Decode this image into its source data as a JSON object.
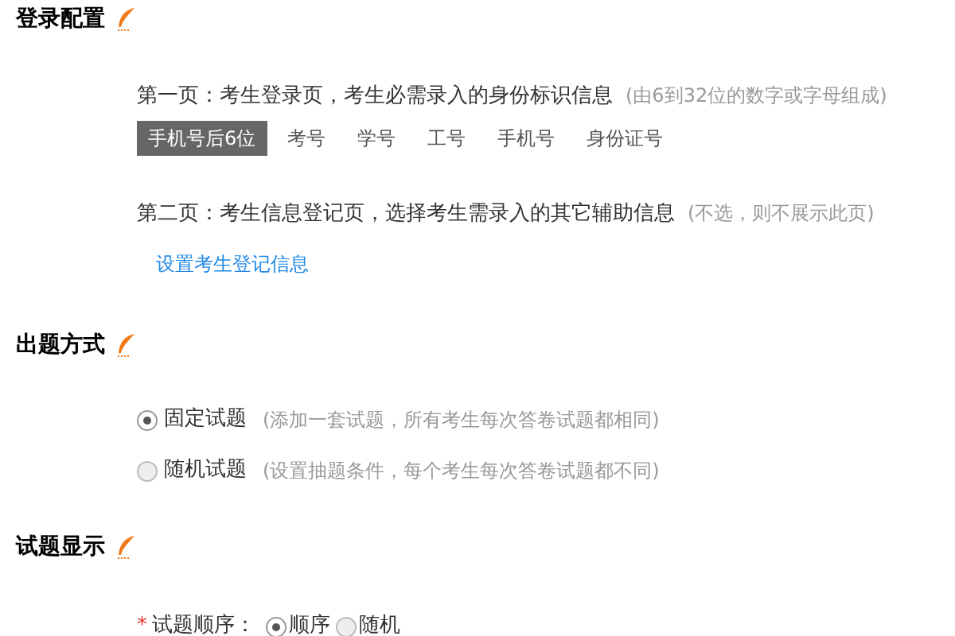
{
  "sections": [
    {
      "title": "登录配置",
      "kind": "login",
      "page1": {
        "label": "第一页：考生登录页，考生必需录入的身份标识信息",
        "note": "(由6到32位的数字或字母组成)"
      },
      "id_options": [
        {
          "label": "手机号后6位",
          "selected": true
        },
        {
          "label": "考号",
          "selected": false
        },
        {
          "label": "学号",
          "selected": false
        },
        {
          "label": "工号",
          "selected": false
        },
        {
          "label": "手机号",
          "selected": false
        },
        {
          "label": "身份证号",
          "selected": false
        }
      ],
      "page2": {
        "label": "第二页：考生信息登记页，选择考生需录入的其它辅助信息",
        "note": "(不选，则不展示此页)"
      },
      "link": "设置考生登记信息"
    },
    {
      "title": "出题方式",
      "kind": "mode",
      "options": [
        {
          "label": "固定试题",
          "note": "(添加一套试题，所有考生每次答卷试题都相同)",
          "selected": true
        },
        {
          "label": "随机试题",
          "note": "(设置抽题条件，每个考生每次答卷试题都不同)",
          "selected": false
        }
      ]
    },
    {
      "title": "试题显示",
      "kind": "display",
      "required_mark": "*",
      "field_label": "试题顺序：",
      "options": [
        {
          "label": "顺序",
          "selected": true
        },
        {
          "label": "随机",
          "selected": false
        }
      ]
    }
  ]
}
